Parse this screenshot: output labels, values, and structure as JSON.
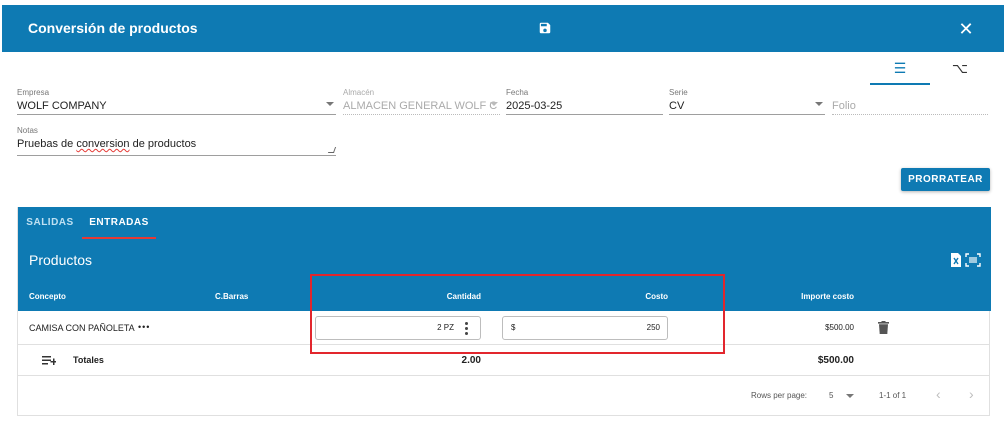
{
  "header": {
    "title": "Conversión de productos",
    "save_icon": "save-icon",
    "close_icon": "close-icon",
    "close_glyph": "✕"
  },
  "view_toggle": {
    "list_glyph": "☰",
    "fork_glyph": "⌥"
  },
  "form": {
    "empresa": {
      "label": "Empresa",
      "value": "WOLF COMPANY"
    },
    "almacen": {
      "label": "Almacén",
      "value": "ALMACEN GENERAL WOLF C"
    },
    "fecha": {
      "label": "Fecha",
      "value": "2025-03-25"
    },
    "serie": {
      "label": "Serie",
      "value": "CV"
    },
    "folio": {
      "placeholder": "Folio"
    },
    "notas": {
      "label": "Notas",
      "value_before": "Pruebas de ",
      "value_misspelled": "conversion",
      "value_after": " de productos"
    }
  },
  "prorratear_label": "PRORRATEAR",
  "tabs": [
    {
      "label": "SALIDAS",
      "active": false
    },
    {
      "label": "ENTRADAS",
      "active": true
    }
  ],
  "products": {
    "title": "Productos",
    "columns": [
      "Concepto",
      "C.Barras",
      "Cantidad",
      "Costo",
      "Importe costo"
    ],
    "rows": [
      {
        "concepto": "CAMISA CON PAÑOLETA",
        "more": "•••",
        "cbarras": "",
        "cantidad": "2 PZ",
        "costo_prefix": "$",
        "costo": "250",
        "importe": "$500.00"
      }
    ],
    "totals": {
      "label": "Totales",
      "cantidad": "2.00",
      "importe": "$500.00"
    }
  },
  "pagination": {
    "rows_per_page_label": "Rows per page:",
    "rows_per_page": "5",
    "range": "1-1 of 1",
    "prev": "‹",
    "next": "›"
  },
  "colors": {
    "primary": "#0e7ab3",
    "highlight": "#e2262d"
  }
}
